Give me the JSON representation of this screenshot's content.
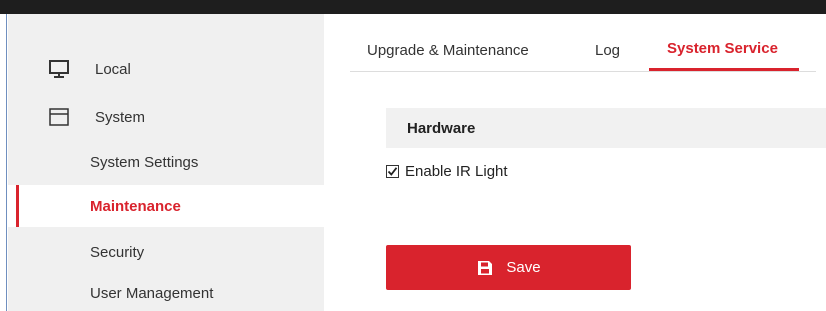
{
  "colors": {
    "accent": "#d9232d",
    "sidebar_bg": "#f0f0f0",
    "section_header_bg": "#f1f1f1"
  },
  "sidebar": {
    "groups": [
      {
        "label": "Local",
        "icon": "monitor-icon"
      },
      {
        "label": "System",
        "icon": "window-icon",
        "items": [
          {
            "label": "System Settings"
          },
          {
            "label": "Maintenance",
            "active": true
          },
          {
            "label": "Security"
          },
          {
            "label": "User Management"
          }
        ]
      }
    ]
  },
  "tabs": [
    {
      "label": "Upgrade & Maintenance"
    },
    {
      "label": "Log"
    },
    {
      "label": "System Service",
      "active": true
    }
  ],
  "section": {
    "title": "Hardware"
  },
  "options": {
    "enable_ir_light": {
      "label": "Enable IR Light",
      "checked": true
    }
  },
  "actions": {
    "save": {
      "label": "Save",
      "icon": "save-icon"
    }
  }
}
